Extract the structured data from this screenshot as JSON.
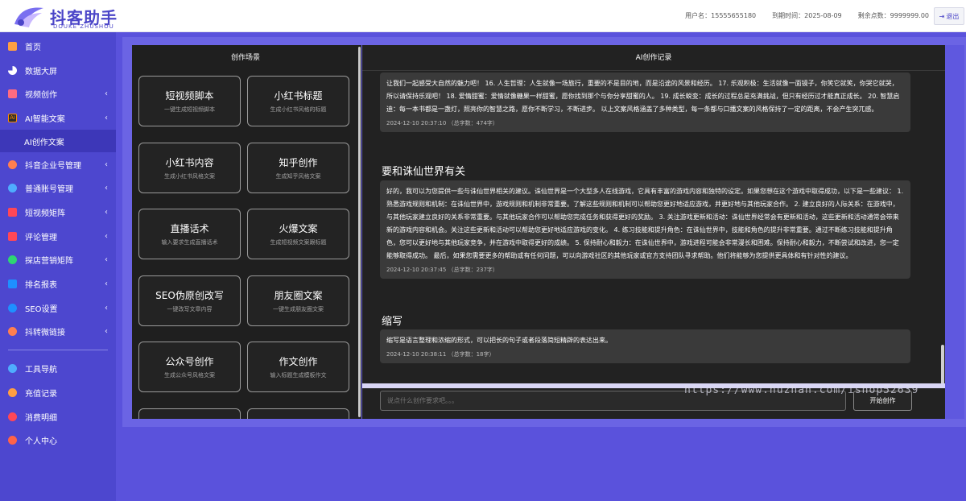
{
  "header": {
    "logo_title": "抖客助手",
    "logo_sub": "DOUKE ZHUSHOU",
    "username_label": "用户名：",
    "username": "15555655180",
    "expire_label": "到期时间：",
    "expire": "2025-08-09",
    "points_label": "剩余点数：",
    "points": "9999999.00",
    "logout_label": "退出"
  },
  "sidebar": {
    "items": [
      {
        "label": "首页",
        "icon": "home-icon",
        "color": "#ff9f43",
        "arrow": ""
      },
      {
        "label": "数据大屏",
        "icon": "pie-chart-icon",
        "color": "#ffffff",
        "arrow": ""
      },
      {
        "label": "视频创作",
        "icon": "video-icon",
        "color": "#ff6b81",
        "arrow": "‹"
      },
      {
        "label": "AI智能文案",
        "icon": "ai-icon",
        "color": "#ff8c00",
        "arrow": "‹"
      },
      {
        "label": "AI创作文案",
        "icon": "",
        "color": "",
        "arrow": ""
      },
      {
        "label": "抖音企业号管理",
        "icon": "enterprise-icon",
        "color": "#ff7f50",
        "arrow": "‹"
      },
      {
        "label": "普通账号管理",
        "icon": "account-icon",
        "color": "#4facfe",
        "arrow": "‹"
      },
      {
        "label": "短视频矩阵",
        "icon": "matrix-icon",
        "color": "#ff4757",
        "arrow": "‹"
      },
      {
        "label": "评论管理",
        "icon": "comment-icon",
        "color": "#ff4757",
        "arrow": "‹"
      },
      {
        "label": "探店营销矩阵",
        "icon": "shop-icon",
        "color": "#2ed573",
        "arrow": "‹"
      },
      {
        "label": "排名报表",
        "icon": "rank-icon",
        "color": "#1e90ff",
        "arrow": "‹"
      },
      {
        "label": "SEO设置",
        "icon": "seo-icon",
        "color": "#1e90ff",
        "arrow": "‹"
      },
      {
        "label": "抖转微链接",
        "icon": "link-icon",
        "color": "#ff7f50",
        "arrow": "‹"
      },
      {
        "label": "工具导航",
        "icon": "tool-icon",
        "color": "#4facfe",
        "arrow": ""
      },
      {
        "label": "充值记录",
        "icon": "recharge-icon",
        "color": "#ff9f43",
        "arrow": ""
      },
      {
        "label": "消费明细",
        "icon": "consume-icon",
        "color": "#ff4757",
        "arrow": ""
      },
      {
        "label": "个人中心",
        "icon": "user-icon",
        "color": "#ff6348",
        "arrow": ""
      }
    ]
  },
  "scenes": {
    "title": "创作场景",
    "cards": [
      {
        "title": "短视频脚本",
        "sub": "一键生成短视频脚本"
      },
      {
        "title": "小红书标题",
        "sub": "生成小红书风格的标题"
      },
      {
        "title": "小红书内容",
        "sub": "生成小红书风格文案"
      },
      {
        "title": "知乎创作",
        "sub": "生成知乎风格文案"
      },
      {
        "title": "直播话术",
        "sub": "输入要求生成直播话术"
      },
      {
        "title": "火爆文案",
        "sub": "生成短视频文案跟标题"
      },
      {
        "title": "SEO伪原创改写",
        "sub": "一键改写文章内容"
      },
      {
        "title": "朋友圈文案",
        "sub": "一键生成朋友圈文案"
      },
      {
        "title": "公众号创作",
        "sub": "生成公众号风格文案"
      },
      {
        "title": "作文创作",
        "sub": "输入标题生成模板作文"
      },
      {
        "title": "",
        "sub": ""
      },
      {
        "title": "",
        "sub": ""
      }
    ]
  },
  "records": {
    "title": "AI创作记录",
    "entries": [
      {
        "question": "",
        "answer": "让我们一起感受大自然的魅力吧！ 16. 人生哲理：人生就像一场旅行，重要的不是目的地，而是沿途的风景和经历。 17. 乐观积极：生活就像一面镜子，你笑它就笑，你哭它就哭，所以请保持乐观吧！ 18. 爱情甜蜜：爱情就像糖果一样甜蜜，愿你找到那个与你分享甜蜜的人。 19. 成长蜕变：成长的过程总是充满挑战，但只有经历过才能真正成长。 20. 智慧启迪：每一本书都是一盏灯，照亮你的智慧之路，愿你不断学习，不断进步。 以上文案风格涵盖了多种类型，每一条都与口播文案的风格保持了一定的距离，不会产生突兀感。",
        "meta": "2024-12-10 20:37:10 （总字数：474字）"
      },
      {
        "question": "要和诛仙世界有关",
        "answer": "好的，我可以为您提供一些与诛仙世界相关的建议。诛仙世界是一个大型多人在线游戏，它具有丰富的游戏内容和独特的设定。如果您想在这个游戏中取得成功，以下是一些建议： 1. 熟悉游戏规则和机制：在诛仙世界中，游戏规则和机制非常重要。了解这些规则和机制可以帮助您更好地适应游戏，并更好地与其他玩家合作。 2. 建立良好的人际关系：在游戏中，与其他玩家建立良好的关系非常重要。与其他玩家合作可以帮助您完成任务和获得更好的奖励。 3. 关注游戏更新和活动：诛仙世界经常会有更新和活动，这些更新和活动通常会带来新的游戏内容和机会。关注这些更新和活动可以帮助您更好地适应游戏的变化。 4. 练习技能和提升角色：在诛仙世界中，技能和角色的提升非常重要。通过不断练习技能和提升角色，您可以更好地与其他玩家竞争，并在游戏中取得更好的成绩。 5. 保持耐心和毅力：在诛仙世界中，游戏进程可能会非常漫长和困难。保持耐心和毅力，不断尝试和改进，您一定能够取得成功。 最后，如果您需要更多的帮助或有任何问题，可以向游戏社区的其他玩家或官方支持团队寻求帮助。他们将能够为您提供更具体和有针对性的建议。",
        "meta": "2024-12-10 20:37:45 （总字数：237字）"
      },
      {
        "question": "缩写",
        "answer": "缩写是语言整理和浓缩的形式，可以把长的句子或者段落简短精辟的表达出来。",
        "meta": "2024-12-10 20:38:11 （总字数：18字）"
      }
    ]
  },
  "chat": {
    "placeholder": "说点什么创作要求吧。。。",
    "submit_label": "开始创作"
  },
  "watermark": "https://www.huzhan.com/ishop52639"
}
